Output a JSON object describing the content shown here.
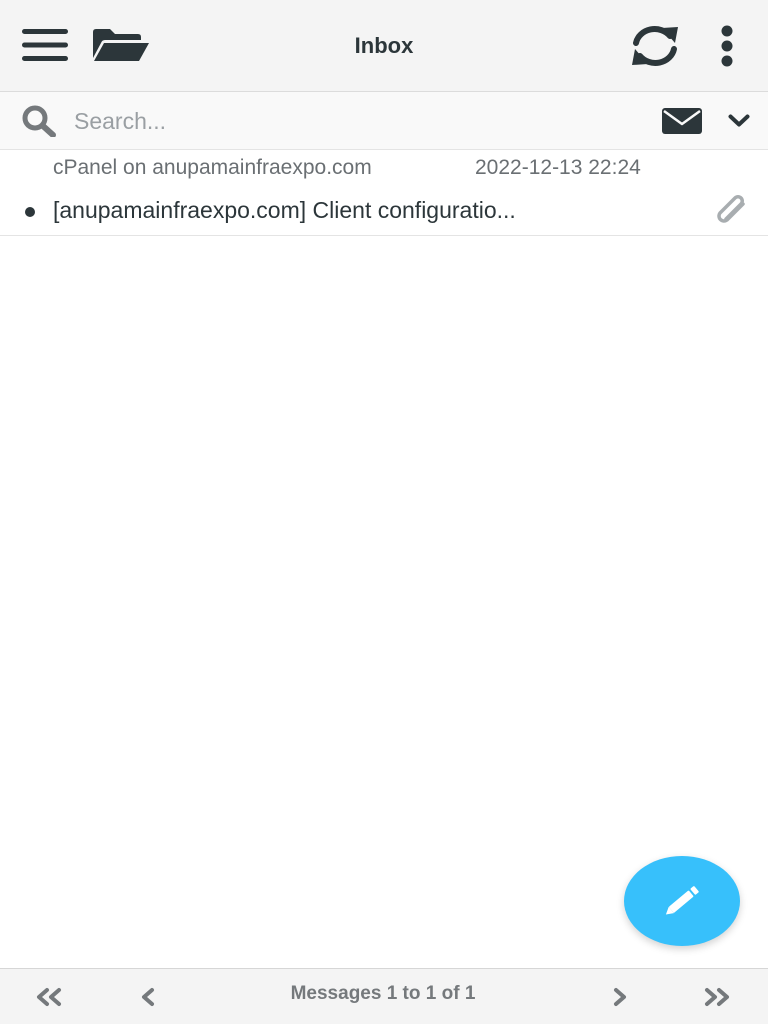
{
  "header": {
    "title": "Inbox",
    "icons": [
      "menu-icon",
      "folder-open-icon",
      "refresh-icon",
      "more-vertical-icon"
    ]
  },
  "search": {
    "placeholder": "Search...",
    "value": "",
    "icons": [
      "search-icon",
      "envelope-icon",
      "chevron-down-icon"
    ]
  },
  "messages": [
    {
      "sender": "cPanel on anupamainfraexpo.com",
      "date": "2022-12-13 22:24",
      "subject": "[anupamainfraexpo.com] Client configuratio...",
      "unread": true,
      "has_attachment": true
    }
  ],
  "footer": {
    "status": "Messages 1 to 1 of 1",
    "icons": [
      "first-page-icon",
      "previous-page-icon",
      "next-page-icon",
      "last-page-icon"
    ]
  },
  "compose": {
    "icon": "pencil-icon"
  },
  "colors": {
    "header_bg": "#f4f4f4",
    "text_dark": "#2c363a",
    "text_muted": "#6a6f73",
    "accent": "#37c0fb",
    "icon_gray": "#a8adb0"
  }
}
